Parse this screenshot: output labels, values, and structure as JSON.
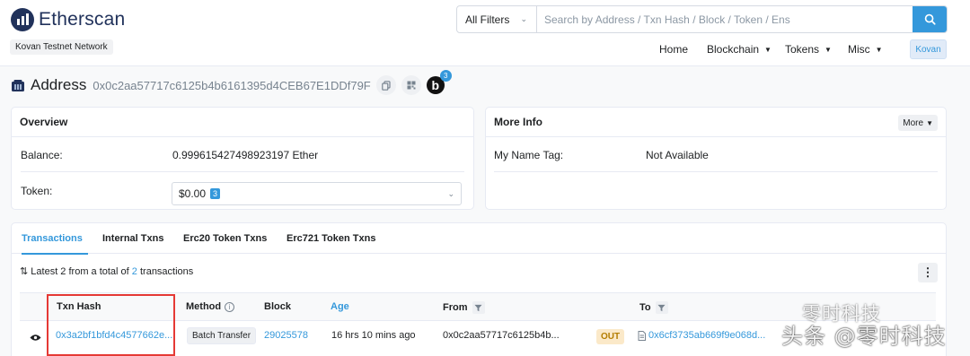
{
  "header": {
    "brand": "Etherscan",
    "network": "Kovan Testnet Network",
    "search": {
      "filter_label": "All Filters",
      "placeholder": "Search by Address / Txn Hash / Block / Token / Ens"
    },
    "nav": [
      {
        "label": "Home"
      },
      {
        "label": "Blockchain"
      },
      {
        "label": "Tokens"
      },
      {
        "label": "Misc"
      }
    ],
    "network_button": "Kovan"
  },
  "address": {
    "title": "Address",
    "hash": "0x0c2aa57717c6125b4b6161395d4CEB67E1DDf79F",
    "badge_letter": "b",
    "badge_count": "3"
  },
  "overview": {
    "title": "Overview",
    "balance_label": "Balance:",
    "balance_value": "0.999615427498923197 Ether",
    "token_label": "Token:",
    "token_value": "$0.00",
    "token_count": "3"
  },
  "more_info": {
    "title": "More Info",
    "more_button": "More",
    "name_tag_label": "My Name Tag:",
    "name_tag_value": "Not Available"
  },
  "tabs": [
    {
      "label": "Transactions"
    },
    {
      "label": "Internal Txns"
    },
    {
      "label": "Erc20 Token Txns"
    },
    {
      "label": "Erc721 Token Txns"
    }
  ],
  "summary": {
    "prefix": "Latest 2 from a total of ",
    "count": "2",
    "suffix": " transactions"
  },
  "table": {
    "headers": {
      "txn_hash": "Txn Hash",
      "method": "Method",
      "block": "Block",
      "age": "Age",
      "from": "From",
      "to": "To"
    },
    "rows": [
      {
        "txn_hash": "0x3a2bf1bfd4c4577662e...",
        "method": "Batch Transfer",
        "block": "29025578",
        "age": "16 hrs 10 mins ago",
        "from": "0x0c2aa57717c6125b4b...",
        "direction": "OUT",
        "to": "0x6cf3735ab669f9e068d..."
      }
    ]
  },
  "watermark": {
    "line1": "零时科技",
    "line2": "头条 @零时科技"
  },
  "colors": {
    "accent": "#3498db",
    "brand": "#21325b",
    "highlight_box": "#e53935"
  }
}
